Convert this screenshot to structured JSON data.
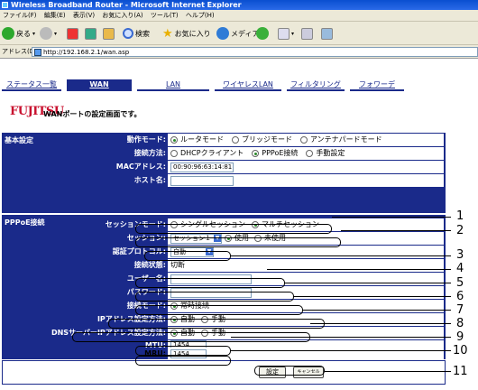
{
  "window": {
    "title": "Wireless Broadband Router - Microsoft Internet Explorer"
  },
  "menu": [
    "ファイル(F)",
    "編集(E)",
    "表示(V)",
    "お気に入り(A)",
    "ツール(T)",
    "ヘルプ(H)"
  ],
  "toolbar": {
    "back_label": "戻る",
    "search_label": "検索",
    "favorites_label": "お気に入り",
    "media_label": "メディア"
  },
  "address": {
    "label": "アドレス(D)",
    "url": "http://192.168.2.1/wan.asp"
  },
  "tabs": [
    {
      "label": "ステータス一覧",
      "active": false
    },
    {
      "label": "WAN",
      "active": true
    },
    {
      "label": "LAN",
      "active": false
    },
    {
      "label": "ワイヤレスLAN",
      "active": false
    },
    {
      "label": "フィルタリング",
      "active": false
    },
    {
      "label": "フォワーデ",
      "active": false
    }
  ],
  "header": {
    "logo": "FUJITSU",
    "title": "WANポートの設定画面です。"
  },
  "basic": {
    "section_label": "基本設定",
    "mode_label": "動作モード:",
    "mode_options": [
      "ルータモード",
      "ブリッジモード",
      "アンテナパードモード"
    ],
    "mode_selected": 0,
    "conn_label": "接続方法:",
    "conn_options": [
      "DHCPクライアント",
      "PPPoE接続",
      "手動設定"
    ],
    "conn_selected": 1,
    "mac_label": "MACアドレス:",
    "mac_value": "00:90:96:63:14:81",
    "host_label": "ホスト名:",
    "host_value": ""
  },
  "pppoe": {
    "section_label": "PPPoE接続",
    "session_mode_label": "セッションモード:",
    "session_mode_options": [
      "シングルセッション",
      "マルチセッション"
    ],
    "session_mode_selected": 1,
    "session_label": "セッション:",
    "session_value": "セッション１",
    "session_use_options": [
      "使用",
      "未使用"
    ],
    "session_use_selected": 0,
    "auth_label": "認証プロトコル:",
    "auth_value": "自動",
    "status_label": "接続状態:",
    "status_value": "切断",
    "user_label": "ユーザー名:",
    "user_value": "",
    "pass_label": "パスワード:",
    "pass_value": "",
    "connmode_label": "接続モード:",
    "connmode_option": "常時接続",
    "ip_label": "IPアドレス設定方法:",
    "ip_options": [
      "自動",
      "手動"
    ],
    "ip_selected": 0,
    "dns_label": "DNSサーバーIPアドレス設定方法:",
    "dns_options": [
      "自動",
      "手動"
    ],
    "dns_selected": 0,
    "mtu_label": "MTU:",
    "mtu_value": "1454",
    "mru_label": "MRU:",
    "mru_value": "1454"
  },
  "actions": {
    "set_label": "設定",
    "cancel_label": "キャンセル"
  },
  "callouts": [
    "1",
    "2",
    "3",
    "4",
    "5",
    "6",
    "7",
    "8",
    "9",
    "10",
    "11"
  ]
}
